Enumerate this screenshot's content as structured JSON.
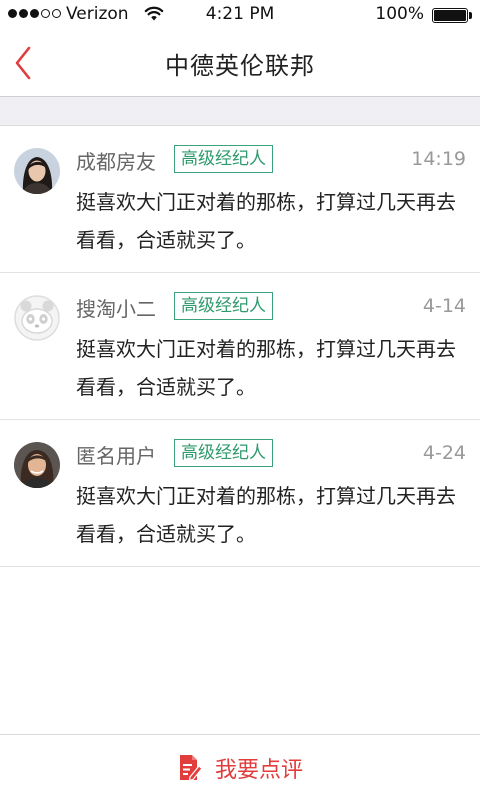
{
  "status_bar": {
    "carrier": "Verizon",
    "time": "4:21 PM",
    "battery": "100%"
  },
  "nav": {
    "title": "中德英伦联邦"
  },
  "comments": [
    {
      "name": "成都房友",
      "badge": "高级经纪人",
      "time": "14:19",
      "text": "挺喜欢大门正对着的那栋，打算过几天再去看看，合适就买了。",
      "avatar": "female-portrait"
    },
    {
      "name": "搜淘小二",
      "badge": "高级经纪人",
      "time": "4-14",
      "text": "挺喜欢大门正对着的那栋，打算过几天再去看看，合适就买了。",
      "avatar": "panda-default-avatar"
    },
    {
      "name": "匿名用户",
      "badge": "高级经纪人",
      "time": "4-24",
      "text": "挺喜欢大门正对着的那栋，打算过几天再去看看，合适就买了。",
      "avatar": "female-portrait"
    }
  ],
  "bottom_bar": {
    "label": "我要点评",
    "icon": "edit-note-icon"
  },
  "colors": {
    "accent_red": "#e23d3d",
    "badge_green": "#2f9a6e"
  }
}
